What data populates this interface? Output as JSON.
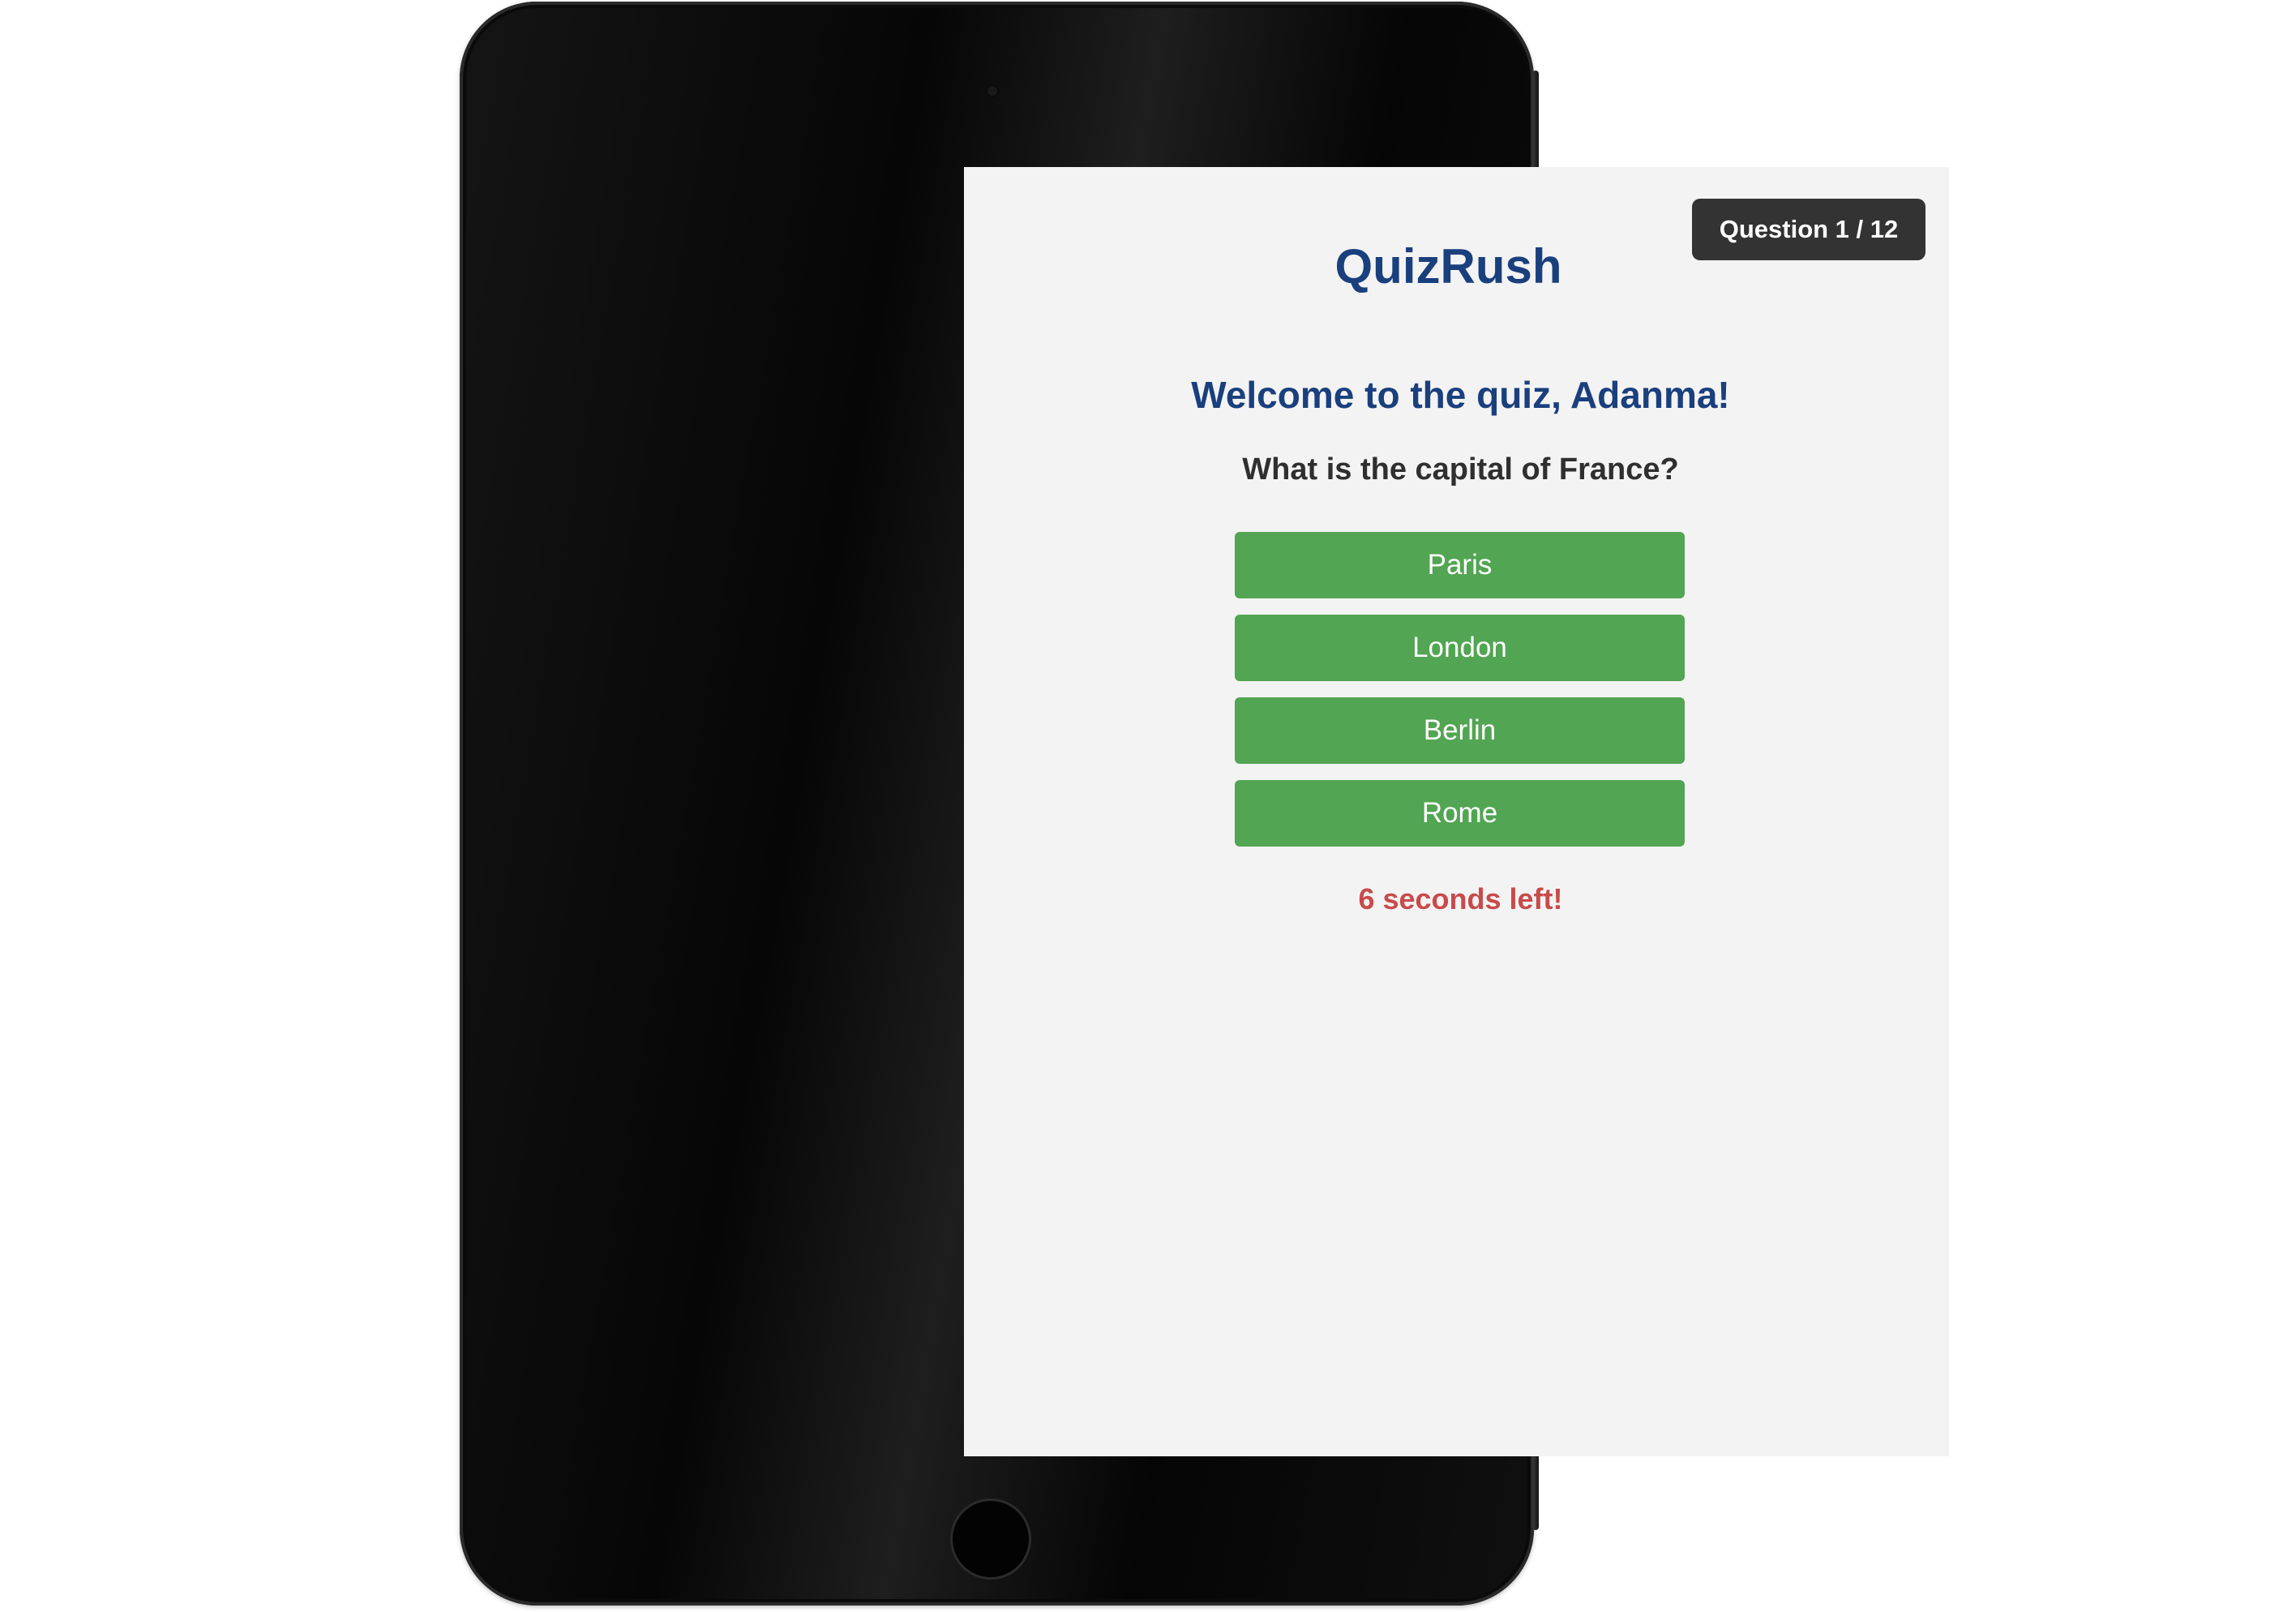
{
  "app": {
    "title": "QuizRush"
  },
  "progress": {
    "label": "Question 1 / 12",
    "current": 1,
    "total": 12
  },
  "quiz": {
    "welcome": "Welcome to the quiz, Adanma!",
    "question": "What is the capital of France?",
    "answers": [
      {
        "label": "Paris"
      },
      {
        "label": "London"
      },
      {
        "label": "Berlin"
      },
      {
        "label": "Rome"
      }
    ],
    "timer_text": "6 seconds left!"
  },
  "colors": {
    "title": "#1a3f7d",
    "answer_button": "#52a552",
    "counter_badge": "#333333",
    "timer": "#c94a4a",
    "screen_background": "#f3f3f3"
  }
}
